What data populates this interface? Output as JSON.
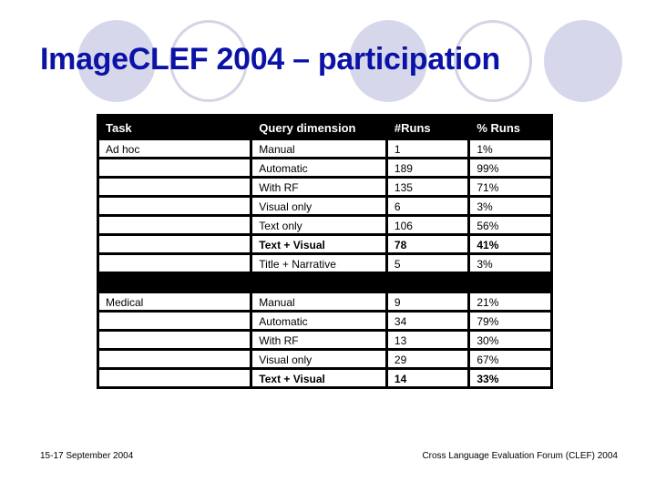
{
  "slide": {
    "title": "ImageCLEF 2004 – participation",
    "title_color": "#0b12a6",
    "decoration_color": "#d7d7ec"
  },
  "table": {
    "headers": [
      "Task",
      "Query dimension",
      "#Runs",
      "% Runs"
    ],
    "groups": [
      {
        "task": "Ad hoc",
        "rows": [
          {
            "query": "Manual",
            "runs": "1",
            "pct": "1%",
            "bold": false
          },
          {
            "query": "Automatic",
            "runs": "189",
            "pct": "99%",
            "bold": false
          },
          {
            "query": "With RF",
            "runs": "135",
            "pct": "71%",
            "bold": false
          },
          {
            "query": "Visual only",
            "runs": "6",
            "pct": "3%",
            "bold": false
          },
          {
            "query": "Text only",
            "runs": "106",
            "pct": "56%",
            "bold": false
          },
          {
            "query": "Text + Visual",
            "runs": "78",
            "pct": "41%",
            "bold": true
          },
          {
            "query": "Title + Narrative",
            "runs": "5",
            "pct": "3%",
            "bold": false
          }
        ]
      },
      {
        "task": "Medical",
        "rows": [
          {
            "query": "Manual",
            "runs": "9",
            "pct": "21%",
            "bold": false
          },
          {
            "query": "Automatic",
            "runs": "34",
            "pct": "79%",
            "bold": false
          },
          {
            "query": "With RF",
            "runs": "13",
            "pct": "30%",
            "bold": false
          },
          {
            "query": "Visual only",
            "runs": "29",
            "pct": "67%",
            "bold": false
          },
          {
            "query": "Text + Visual",
            "runs": "14",
            "pct": "33%",
            "bold": true
          }
        ]
      }
    ]
  },
  "footer": {
    "date": "15-17 September 2004",
    "organization": "Cross Language Evaluation Forum (CLEF) 2004"
  }
}
